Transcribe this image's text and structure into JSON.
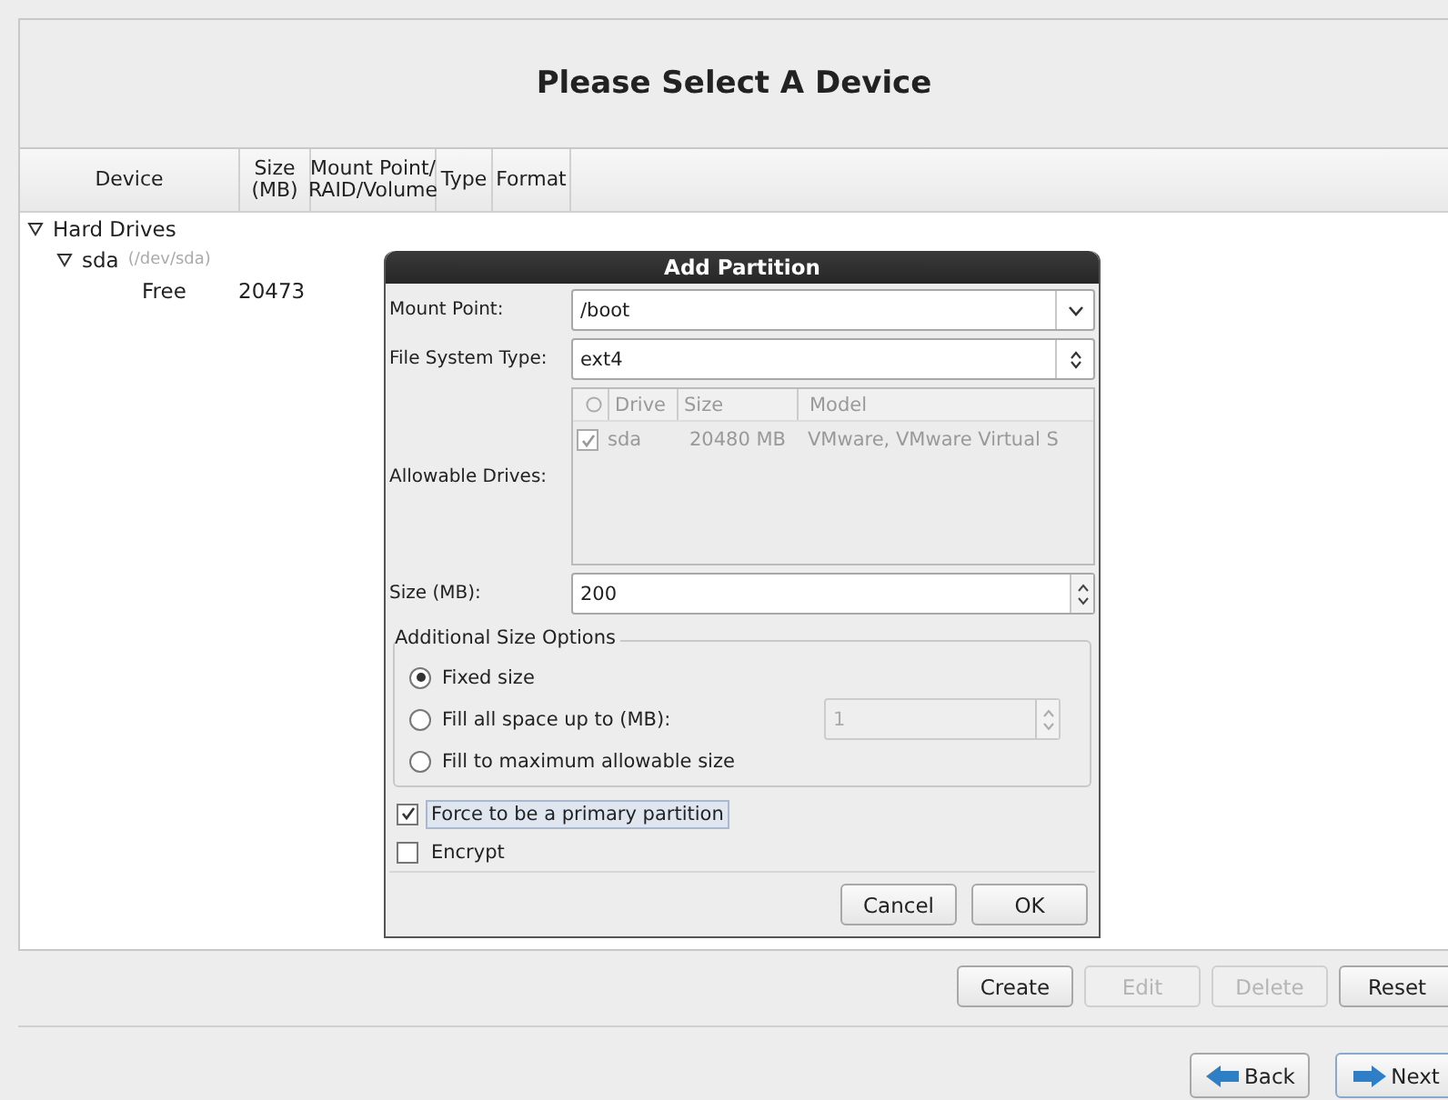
{
  "header": {
    "title": "Please Select A Device"
  },
  "table": {
    "columns": [
      [
        "Device"
      ],
      [
        "Size",
        "(MB)"
      ],
      [
        "Mount Point/",
        "RAID/Volume"
      ],
      [
        "Type"
      ],
      [
        "Format"
      ]
    ],
    "rows": [
      {
        "device": "Hard Drives",
        "expanded": true,
        "children": [
          {
            "device": "sda",
            "detail": "(/dev/sda)",
            "expanded": true,
            "children": [
              {
                "device": "Free",
                "size": "20473"
              }
            ]
          }
        ]
      }
    ]
  },
  "dialog": {
    "title": "Add Partition",
    "mount_point": {
      "label": "Mount Point:",
      "value": "/boot"
    },
    "file_system_type": {
      "label": "File System Type:",
      "value": "ext4"
    },
    "allowable_drives": {
      "label": "Allowable Drives:",
      "disabled": true,
      "columns": [
        "Drive",
        "Size",
        "Model"
      ],
      "rows": [
        {
          "checked": true,
          "drive": "sda",
          "size": "20480 MB",
          "model": "VMware, VMware Virtual S"
        }
      ]
    },
    "size": {
      "label": "Size (MB):",
      "value": "200"
    },
    "size_options": {
      "legend": "Additional Size Options",
      "options": [
        {
          "label": "Fixed size",
          "selected": true
        },
        {
          "label": "Fill all space up to (MB):",
          "selected": false,
          "spin_value": "1"
        },
        {
          "label": "Fill to maximum allowable size",
          "selected": false
        }
      ]
    },
    "checkboxes": [
      {
        "label": "Force to be a primary partition",
        "checked": true,
        "focused": true
      },
      {
        "label": "Encrypt",
        "checked": false,
        "focused": false
      }
    ],
    "buttons": [
      "Cancel",
      "OK"
    ]
  },
  "actions": [
    {
      "label": "Create",
      "disabled": false
    },
    {
      "label": "Edit",
      "disabled": true
    },
    {
      "label": "Delete",
      "disabled": true
    },
    {
      "label": "Reset",
      "disabled": false
    }
  ],
  "navigation": [
    {
      "label": "Back",
      "kind": "back"
    },
    {
      "label": "Next",
      "kind": "next"
    }
  ]
}
